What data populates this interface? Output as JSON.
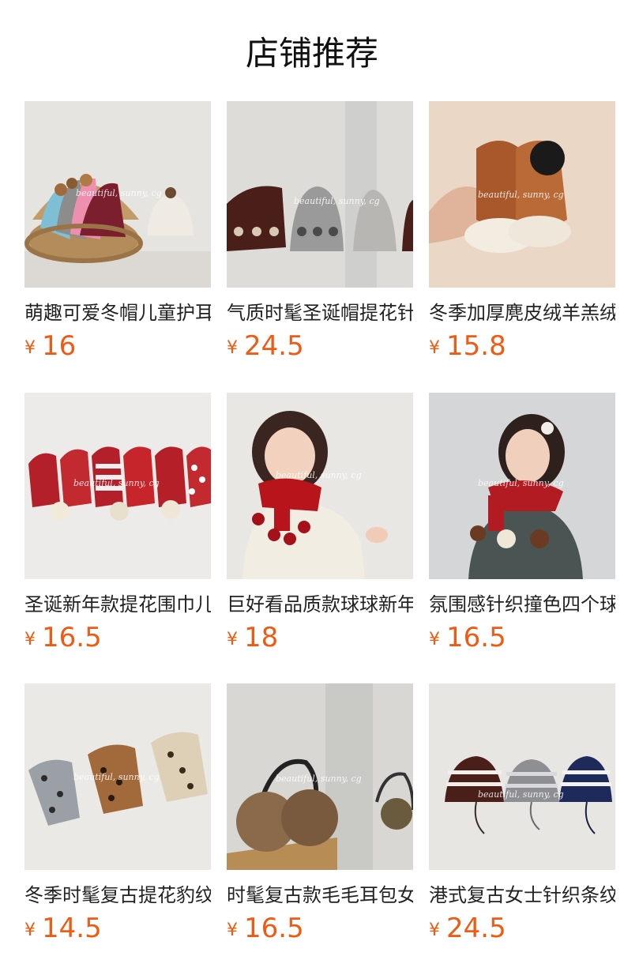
{
  "page": {
    "title": "店铺推荐"
  },
  "products": [
    {
      "name": "萌趣可爱冬帽儿童护耳",
      "currency": "¥",
      "price": "16",
      "watermark": "beautiful, sunny, cg"
    },
    {
      "name": "气质时髦圣诞帽提花针织",
      "currency": "¥",
      "price": "24.5",
      "watermark": "beautiful, sunny, cg"
    },
    {
      "name": "冬季加厚麂皮绒羊羔绒",
      "currency": "¥",
      "price": "15.8",
      "watermark": "beautiful, sunny, cg"
    },
    {
      "name": "圣诞新年款提花围巾儿",
      "currency": "¥",
      "price": "16.5",
      "watermark": "beautiful, sunny, cg"
    },
    {
      "name": "巨好看品质款球球新年",
      "currency": "¥",
      "price": "18",
      "watermark": "beautiful, sunny, cg"
    },
    {
      "name": "氛围感针织撞色四个球",
      "currency": "¥",
      "price": "16.5",
      "watermark": "beautiful, sunny, cg"
    },
    {
      "name": "冬季时髦复古提花豹纹",
      "currency": "¥",
      "price": "14.5",
      "watermark": "beautiful, sunny, cg"
    },
    {
      "name": "时髦复古款毛毛耳包女",
      "currency": "¥",
      "price": "16.5",
      "watermark": "beautiful, sunny, cg"
    },
    {
      "name": "港式复古女士针织条纹",
      "currency": "¥",
      "price": "24.5",
      "watermark": "beautiful, sunny, cg"
    }
  ]
}
